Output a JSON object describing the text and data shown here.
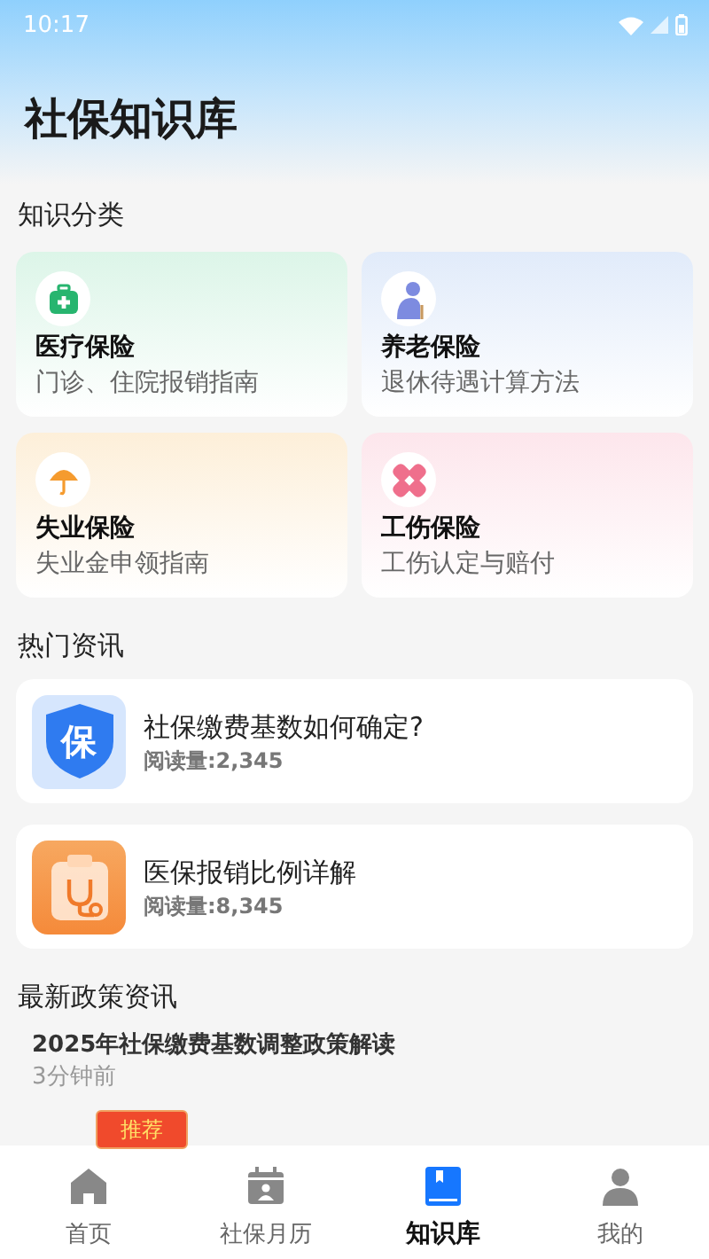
{
  "status_bar": {
    "time": "10:17"
  },
  "title": "社保知识库",
  "categories_title": "知识分类",
  "categories": [
    {
      "kind": "medical",
      "name": "医疗保险",
      "desc": "门诊、住院报销指南"
    },
    {
      "kind": "pension",
      "name": "养老保险",
      "desc": "退休待遇计算方法"
    },
    {
      "kind": "unemployment",
      "name": "失业保险",
      "desc": "失业金申领指南"
    },
    {
      "kind": "injury",
      "name": "工伤保险",
      "desc": "工伤认定与赔付"
    }
  ],
  "hot_title": "热门资讯",
  "hot": [
    {
      "kind": "shield",
      "icon_text": "保",
      "title": "社保缴费基数如何确定?",
      "reads": "阅读量:2,345"
    },
    {
      "kind": "clipboard",
      "title": "医保报销比例详解",
      "reads": "阅读量:8,345"
    }
  ],
  "latest_title": "最新政策资讯",
  "latest": [
    {
      "title": "2025年社保缴费基数调整政策解读",
      "time": "3分钟前"
    }
  ],
  "badge": "推荐",
  "tabs": [
    {
      "kind": "home",
      "label": "首页",
      "selected": false
    },
    {
      "kind": "calendar",
      "label": "社保月历",
      "selected": false
    },
    {
      "kind": "book",
      "label": "知识库",
      "selected": true
    },
    {
      "kind": "person",
      "label": "我的",
      "selected": false
    }
  ]
}
